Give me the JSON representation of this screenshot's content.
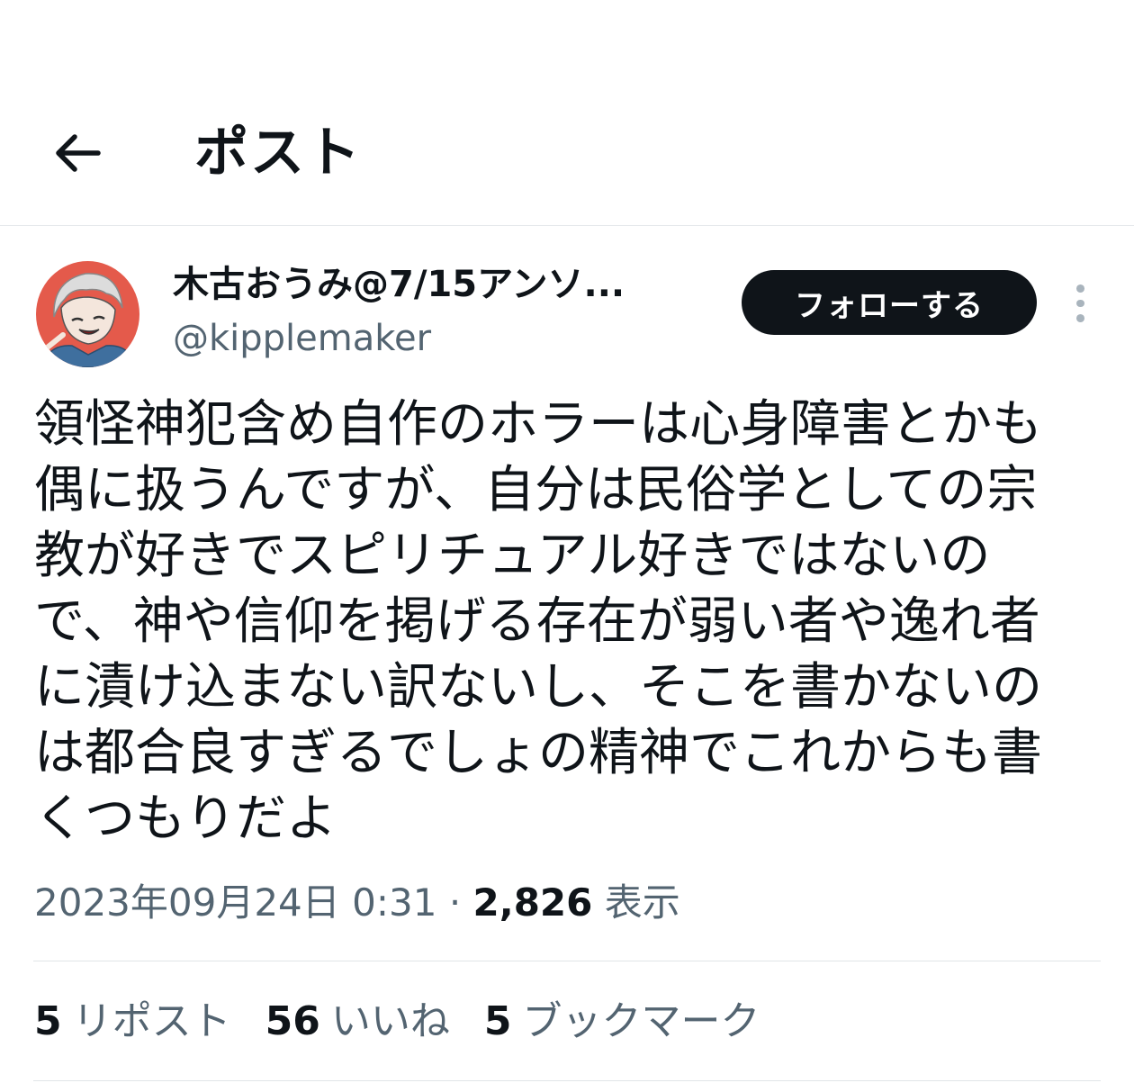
{
  "header": {
    "back_icon": "arrow-left-icon",
    "title": "ポスト"
  },
  "author": {
    "display_name": "木古おうみ@7/15アンソ...",
    "handle": "@kipplemaker",
    "avatar_bg": "#e45a4b"
  },
  "follow_button": {
    "label": "フォローする"
  },
  "more_icon": "more-vertical-icon",
  "post": {
    "text": "領怪神犯含め自作のホラーは心身障害とかも\n偶に扱うんですが、自分は民俗学としての宗\n教が好きでスピリチュアル好きではないの\nで、神や信仰を掲げる存在が弱い者や逸れ者\nに漬け込まない訳ないし、そこを書かないの\nは都合良すぎるでしょの精神でこれからも書\nくつもりだよ",
    "timestamp": "2023年09月24日 0:31",
    "separator": "·",
    "view_count": "2,826",
    "view_label": "表示"
  },
  "stats": [
    {
      "count": "5",
      "label": "リポスト"
    },
    {
      "count": "56",
      "label": "いいね"
    },
    {
      "count": "5",
      "label": "ブックマーク"
    }
  ],
  "colors": {
    "text_primary": "#0f1419",
    "text_secondary": "#536471",
    "divider": "#e1e5e8",
    "follow_bg": "#0f1419"
  }
}
